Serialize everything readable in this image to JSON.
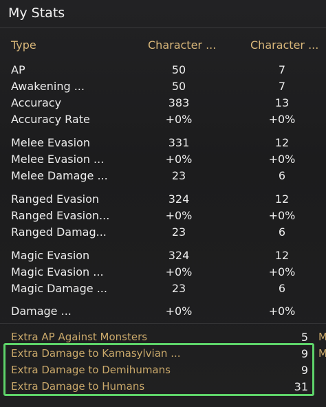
{
  "panel": {
    "title": "My Stats"
  },
  "columns": {
    "type": "Type",
    "col1": "Character ...",
    "col2": "Character ..."
  },
  "rows": [
    {
      "label": "AP",
      "v1": "50",
      "v2": "7"
    },
    {
      "label": "Awakening ...",
      "v1": "50",
      "v2": "7"
    },
    {
      "label": "Accuracy",
      "v1": "383",
      "v2": "13"
    },
    {
      "label": "Accuracy Rate",
      "v1": "+0%",
      "v2": "+0%"
    },
    {
      "label": "Melee Evasion",
      "v1": "331",
      "v2": "12"
    },
    {
      "label": "Melee Evasion ...",
      "v1": "+0%",
      "v2": "+0%"
    },
    {
      "label": "Melee Damage ...",
      "v1": "23",
      "v2": "6"
    },
    {
      "label": "Ranged Evasion",
      "v1": "324",
      "v2": "12"
    },
    {
      "label": "Ranged Evasion...",
      "v1": "+0%",
      "v2": "+0%"
    },
    {
      "label": "Ranged Damag...",
      "v1": "23",
      "v2": "6"
    },
    {
      "label": "Magic Evasion",
      "v1": "324",
      "v2": "12"
    },
    {
      "label": "Magic Evasion ...",
      "v1": "+0%",
      "v2": "+0%"
    },
    {
      "label": "Magic Damage ...",
      "v1": "23",
      "v2": "6"
    },
    {
      "label": "Damage ...",
      "v1": "+0%",
      "v2": "+0%"
    }
  ],
  "extras": [
    {
      "label": "Extra AP Against Monsters",
      "value": "5",
      "side": "M"
    },
    {
      "label": "Extra Damage to Kamasylvian ...",
      "value": "9",
      "side": "M"
    },
    {
      "label": "Extra Damage to Demihumans",
      "value": "9",
      "side": ""
    },
    {
      "label": "Extra Damage to Humans",
      "value": "31",
      "side": ""
    }
  ],
  "colors": {
    "header": "#d9b77a",
    "extra_label": "#c9a86a",
    "highlight": "#5ed46a"
  }
}
